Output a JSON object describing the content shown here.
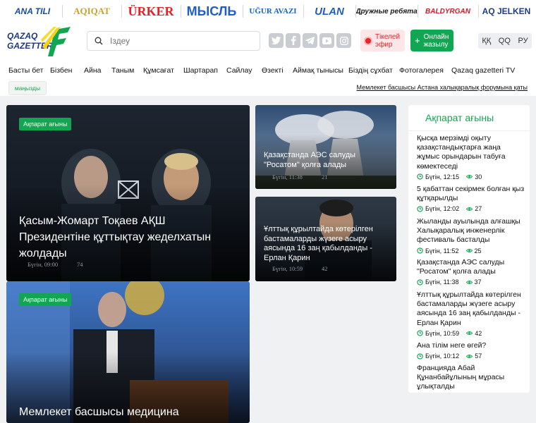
{
  "partners": [
    {
      "label": "ANA TILI",
      "color": "#1a4aa0"
    },
    {
      "label": "AQIQAT",
      "color": "#c9a227"
    },
    {
      "label": "ÜRKER",
      "color": "#e32129"
    },
    {
      "label": "МЫСЛЬ",
      "color": "#1d5fc2"
    },
    {
      "label": "UĞUR AVAZI",
      "color": "#1d5fc2"
    },
    {
      "label": "ULAN",
      "color": "#1d5fc2"
    },
    {
      "label": "Дружные ребята",
      "color": "#1a1a1a"
    },
    {
      "label": "BALDYRGAN",
      "color": "#cc1d2a"
    },
    {
      "label": "AQ JELKEN",
      "color": "#1b3d88"
    }
  ],
  "header": {
    "logo_line1": "QAZAQ",
    "logo_line2": "GAZETTERI",
    "search_placeholder": "Іздеу",
    "social_icons": [
      "twitter-icon",
      "facebook-icon",
      "telegram-icon",
      "youtube-icon",
      "instagram-icon"
    ],
    "live_line1": "Тікелей",
    "live_line2": "эфир",
    "subscribe_line1": "Онлайн",
    "subscribe_line2": "жазылу",
    "languages": [
      "ҚҚ",
      "QQ",
      "РУ"
    ]
  },
  "nav": [
    "Басты бет",
    "Бізбен",
    "Айна",
    "Таным",
    "Құмсағат",
    "Шартарап",
    "Сайлау",
    "Өзекті",
    "Аймақ тынысы",
    "Біздің сұхбат",
    "Фотогалерея",
    "Qazaq gazetteri TV"
  ],
  "ticker": {
    "label": "маңызды",
    "text": "Мемлекет басшысы Астана халықаралық форумына қаты"
  },
  "cards": {
    "main": {
      "badge": "Ақпарат ағыны",
      "title": "Қасым-Жомарт Тоқаев АҚШ Президентіне құттықтау жеделхатын жолдады",
      "time": "Бүгін, 09:00",
      "views": "74"
    },
    "bottom": {
      "badge": "Ақпарат ағыны",
      "title": "Мемлекет басшысы медицина"
    },
    "right_top": {
      "title": "Қазақстанда АЭС салуды \"Росатом\" қолға алады",
      "time": "Бүгін, 11:38",
      "views": "21"
    },
    "right_bottom": {
      "title": "Ұлттық құрылтайда көтерілген бастамаларды жүзеге асыру аясында 16 заң қабылданды - Ерлан Қарин",
      "time": "Бүгін, 10:59",
      "views": "42"
    }
  },
  "feed": {
    "title": "Ақпарат ағыны",
    "items": [
      {
        "title": "Қысқа мерзімді оқыту қазақстандықтарға жаңа жұмыс орындарын табуға көмектеседі",
        "time": "Бүгін, 12:15",
        "views": "30"
      },
      {
        "title": "5 қабаттан секірмек болған қыз құтқарылды",
        "time": "Бүгін, 12:02",
        "views": "27"
      },
      {
        "title": "Жыланды ауылында алғашқы Халықаралық инженерлік фестиваль басталды",
        "time": "Бүгін, 11:52",
        "views": "25"
      },
      {
        "title": "Қазақстанда АЭС салуды \"Росатом\" қолға алады",
        "time": "Бүгін, 11:38",
        "views": "37"
      },
      {
        "title": "Ұлттық құрылтайда көтерілген бастамаларды жүзеге асыру аясында 16 заң қабылданды - Ерлан Қарин",
        "time": "Бүгін, 10:59",
        "views": "42"
      },
      {
        "title": "Ана тілім неге өгей?",
        "time": "Бүгін, 10:12",
        "views": "57"
      },
      {
        "title": "Францияда Абай Құнанбайұлының мұрасы ұлықталды",
        "time": "",
        "views": ""
      }
    ]
  },
  "colors": {
    "accent_green": "#13a652",
    "live_red": "#e5242b"
  }
}
